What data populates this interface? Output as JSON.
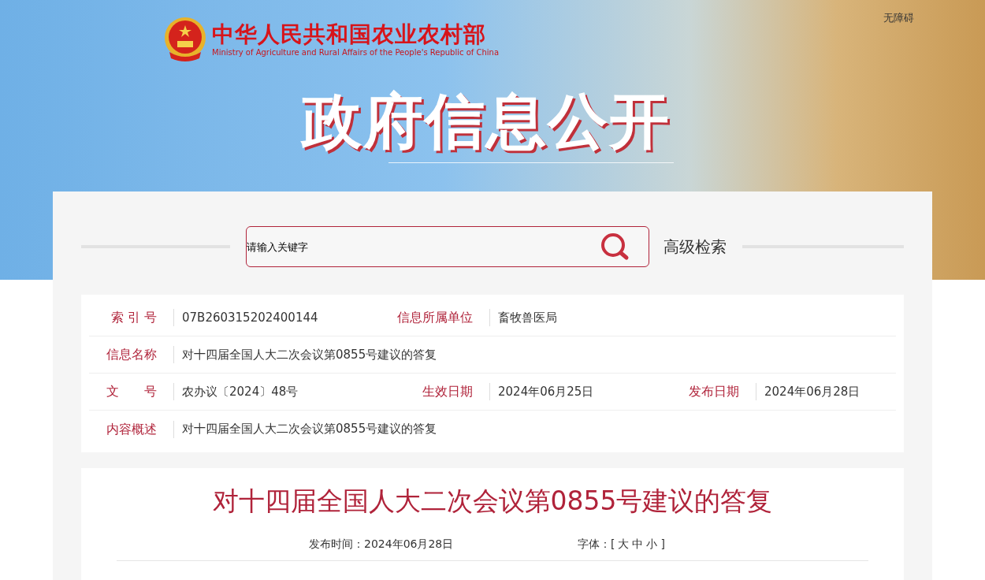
{
  "header": {
    "logo_title": "中华人民共和国农业农村部",
    "logo_subtitle": "Ministry of Agriculture and Rural Affairs of the People's Republic of China",
    "accessibility_link": "无障碍",
    "banner_title": "政府信息公开"
  },
  "search": {
    "placeholder": "请输入关键字",
    "advanced_link": "高级检索"
  },
  "info_rows": [
    [
      {
        "label": "索 引 号",
        "value": "07B260315202400144"
      },
      {
        "label": "信息所属单位",
        "value": "畜牧兽医局"
      }
    ],
    [
      {
        "label": "信息名称",
        "value": "对十四届全国人大二次会议第0855号建议的答复"
      }
    ],
    [
      {
        "label": "文　　号",
        "value": "农办议〔2024〕48号"
      },
      {
        "label": "生效日期",
        "value": "2024年06月25日"
      },
      {
        "label": "发布日期",
        "value": "2024年06月28日"
      }
    ],
    [
      {
        "label": "内容概述",
        "value": "对十四届全国人大二次会议第0855号建议的答复"
      }
    ]
  ],
  "article": {
    "title": "对十四届全国人大二次会议第0855号建议的答复",
    "publish_time": "发布时间：2024年06月28日",
    "font_size": {
      "label": "字体：",
      "open": "[",
      "options": [
        "大",
        "中",
        "小"
      ],
      "close": "]"
    }
  }
}
